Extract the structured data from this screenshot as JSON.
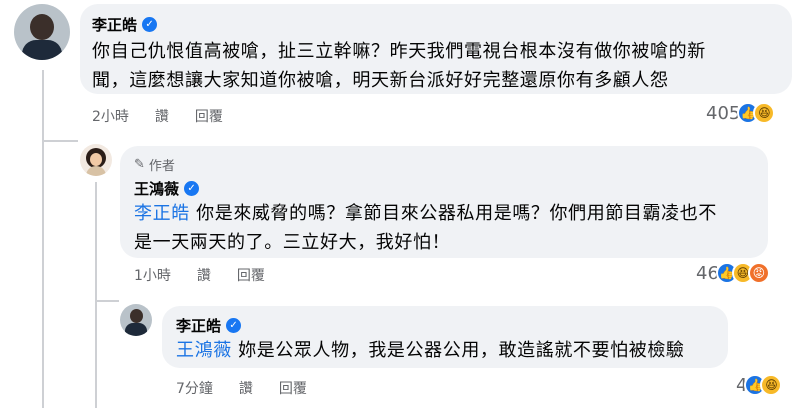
{
  "comment1": {
    "author": "李正皓",
    "text_line1": "你自己仇恨值高被嗆，扯三立幹嘛？昨天我們電視台根本沒有做你被嗆的新",
    "text_line2": "聞，這麼想讓大家知道你被嗆，明天新台派好好完整還原你有多顧人怨",
    "time": "2小時",
    "like_label": "讚",
    "reply_label": "回覆",
    "reaction_count": "405",
    "reactions": [
      "like-icon",
      "haha-icon"
    ]
  },
  "comment2": {
    "author_tag": "作者",
    "author": "王鴻薇",
    "mention": "李正皓",
    "text_line1_rest": " 你是來威脅的嗎？拿節目來公器私用是嗎？你們用節目霸凌也不",
    "text_line2": "是一天兩天的了。三立好大，我好怕！",
    "time": "1小時",
    "like_label": "讚",
    "reply_label": "回覆",
    "reaction_count": "46",
    "reactions": [
      "like-icon",
      "haha-icon",
      "angry-icon"
    ]
  },
  "comment3": {
    "author": "李正皓",
    "mention": "王鴻薇",
    "text_rest": " 妳是公眾人物，我是公器公用，敢造謠就不要怕被檢驗",
    "time": "7分鐘",
    "like_label": "讚",
    "reply_label": "回覆",
    "reaction_count": "4",
    "reactions": [
      "like-icon",
      "haha-icon"
    ]
  },
  "colors": {
    "bubble": "#f0f2f5",
    "mention": "#1b74e4",
    "verified": "#1877f2",
    "meta": "#65676b"
  }
}
